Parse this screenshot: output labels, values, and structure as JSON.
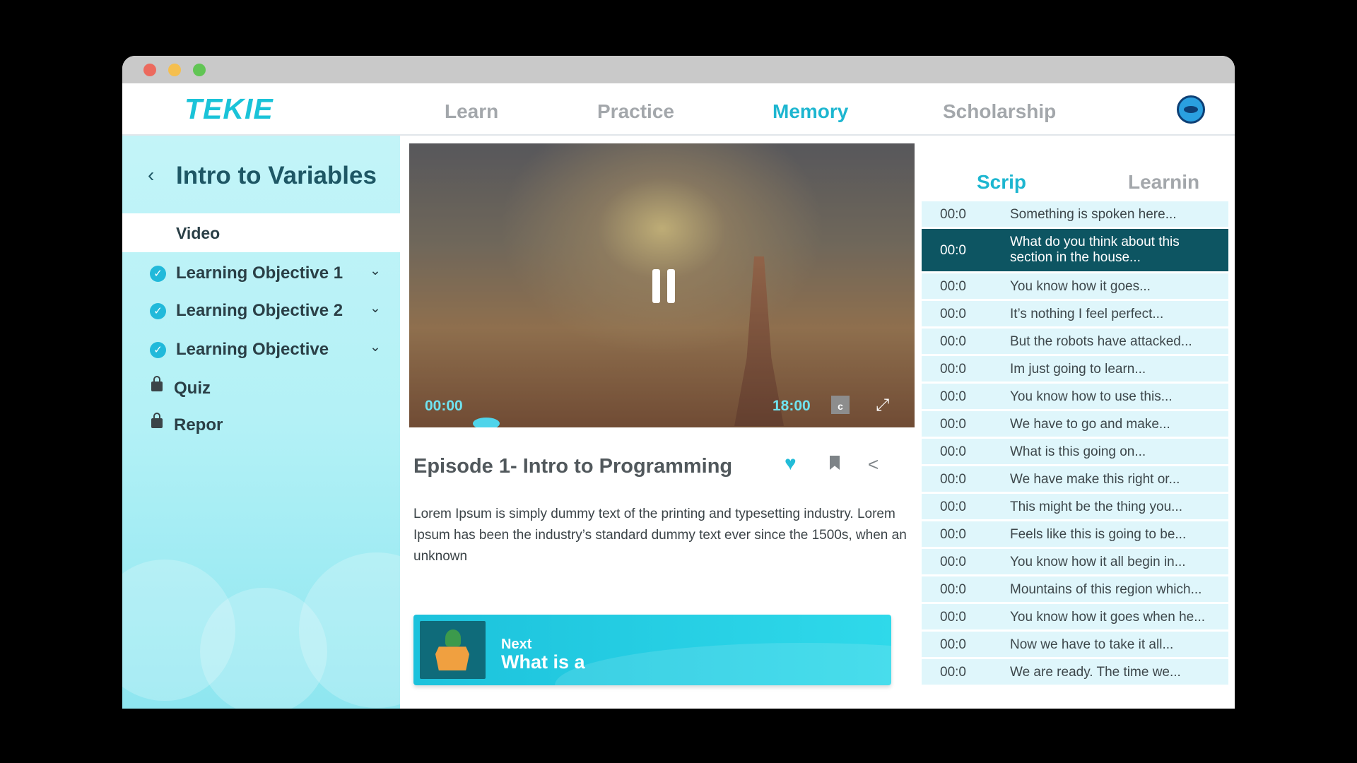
{
  "window": {
    "controls": {
      "close_color": "#ec6a5e",
      "minimize_color": "#f5bf4f",
      "zoom_color": "#61c554"
    }
  },
  "header": {
    "logo": "TEKIE",
    "nav": [
      {
        "label": "Learn",
        "active": false
      },
      {
        "label": "Practice",
        "active": false
      },
      {
        "label": "Memory",
        "active": true
      },
      {
        "label": "Scholarship",
        "active": false
      }
    ],
    "accent": "#1db6d0"
  },
  "sidebar": {
    "course_title": "Intro to Variables",
    "video_label": "Video",
    "objectives": [
      {
        "label": "Learning Objective 1",
        "completed": true
      },
      {
        "label": "Learning Objective 2",
        "completed": true
      },
      {
        "label": "Learning Objective",
        "completed": true
      }
    ],
    "locked_items": [
      {
        "label": "Quiz",
        "locked": true
      },
      {
        "label": "Repor",
        "locked": true
      }
    ]
  },
  "video": {
    "current_time": "00:00",
    "duration": "18:00",
    "cc_label": "c",
    "progress": 0.12
  },
  "episode": {
    "title": "Episode 1- Intro to Programming",
    "description": "Lorem Ipsum is simply dummy text of the printing and typesetting industry. Lorem Ipsum has been the industry’s standard dummy text ever since the 1500s, when an unknown",
    "liked": true
  },
  "next": {
    "kicker": "Next",
    "title": "What is a"
  },
  "transcript": {
    "tabs": [
      {
        "label": "Scrip",
        "active": true
      },
      {
        "label": "Learnin",
        "active": false
      }
    ],
    "rows": [
      {
        "time": "00:0",
        "text": "Something is spoken here..."
      },
      {
        "time": "00:0",
        "text": "What do you think about this section in the house...",
        "active": true
      },
      {
        "time": "00:0",
        "text": "You know how it goes..."
      },
      {
        "time": "00:0",
        "text": "It’s nothing I feel perfect..."
      },
      {
        "time": "00:0",
        "text": "But the robots have attacked..."
      },
      {
        "time": "00:0",
        "text": "Im just going to learn..."
      },
      {
        "time": "00:0",
        "text": "You know how to use this..."
      },
      {
        "time": "00:0",
        "text": "We have to go and make..."
      },
      {
        "time": "00:0",
        "text": "What is this going on..."
      },
      {
        "time": "00:0",
        "text": "We have make this right or..."
      },
      {
        "time": "00:0",
        "text": "This might be the thing you..."
      },
      {
        "time": "00:0",
        "text": "Feels like this is going to be..."
      },
      {
        "time": "00:0",
        "text": "You know how it all begin in..."
      },
      {
        "time": "00:0",
        "text": "Mountains of this region which..."
      },
      {
        "time": "00:0",
        "text": "You know how it goes when he..."
      },
      {
        "time": "00:0",
        "text": "Now we have to take it all..."
      },
      {
        "time": "00:0",
        "text": "We are ready. The time we..."
      }
    ]
  }
}
